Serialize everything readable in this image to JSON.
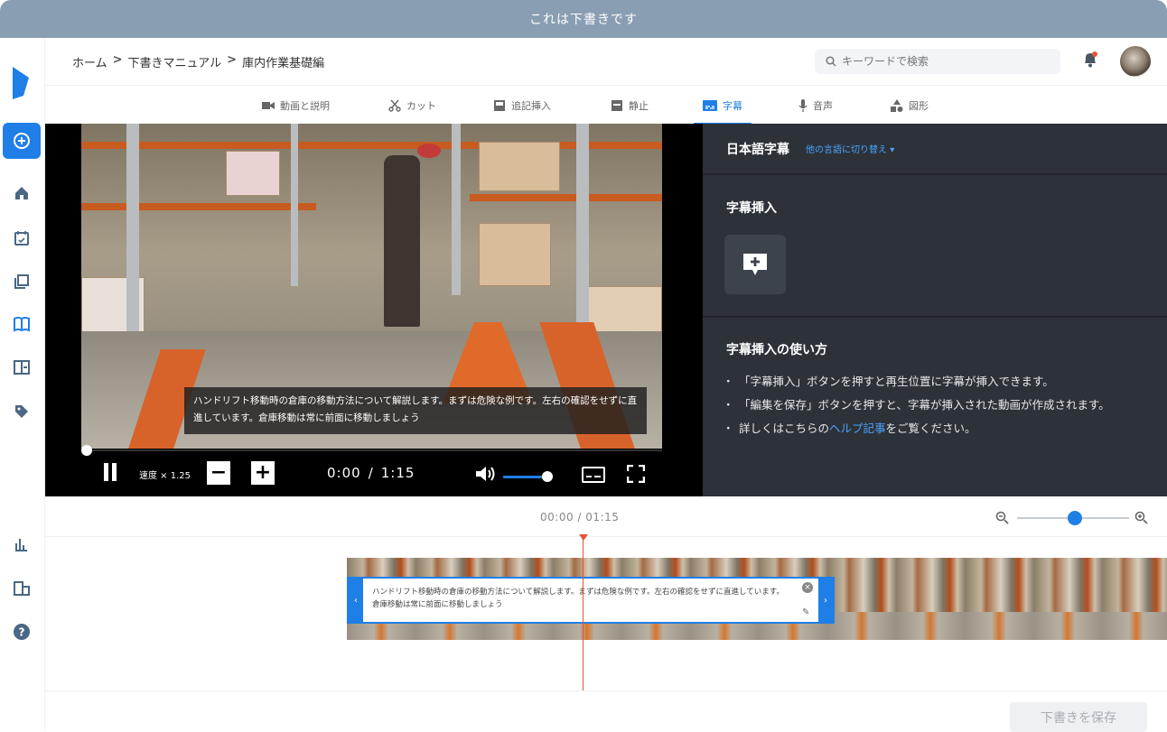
{
  "banner": {
    "text": "これは下書きです"
  },
  "breadcrumb": {
    "items": [
      "ホーム",
      "下書きマニュアル",
      "庫内作業基礎編"
    ],
    "separator": ">"
  },
  "search": {
    "placeholder": "キーワードで検索",
    "icon": "search-icon"
  },
  "sidebar": {
    "items": [
      {
        "icon": "add-circle-icon",
        "active": true
      },
      {
        "icon": "home-icon"
      },
      {
        "icon": "calendar-check-icon"
      },
      {
        "icon": "stacked-pages-icon"
      },
      {
        "icon": "book-icon"
      },
      {
        "icon": "panel-icon"
      },
      {
        "icon": "tag-icon"
      },
      {
        "icon": "bar-chart-icon"
      },
      {
        "icon": "building-icon"
      },
      {
        "icon": "help-icon"
      }
    ]
  },
  "tabs": [
    {
      "label": "動画と説明",
      "icon": "video-camera-icon"
    },
    {
      "label": "カット",
      "icon": "scissors-icon"
    },
    {
      "label": "追記挿入",
      "icon": "insert-icon"
    },
    {
      "label": "静止",
      "icon": "freeze-icon"
    },
    {
      "label": "字幕",
      "icon": "subtitles-icon",
      "active": true
    },
    {
      "label": "音声",
      "icon": "microphone-icon"
    },
    {
      "label": "図形",
      "icon": "shapes-icon"
    }
  ],
  "player": {
    "caption": "ハンドリフト移動時の倉庫の移動方法について解説します。まずは危険な例です。左右の確認をせずに直進しています。倉庫移動は常に前面に移動しましょう",
    "speed_label": "速度 × 1.25",
    "minus": "−",
    "plus": "+",
    "current_time": "0:00",
    "time_separator": "/",
    "duration": "1:15",
    "progress": 0,
    "volume": 0.85
  },
  "panel": {
    "title": "日本語字幕",
    "switch_language": "他の言語に切り替え",
    "insert_label": "字幕挿入",
    "howto_title": "字幕挿入の使い方",
    "howto": {
      "item1": "「字幕挿入」ボタンを押すと再生位置に字幕が挿入できます。",
      "item2": "「編集を保存」ボタンを押すと、字幕が挿入された動画が作成されます。",
      "item3_before": "詳しくはこちらの",
      "item3_link": "ヘルプ記事",
      "item3_after": "をご覧ください。"
    }
  },
  "timeline": {
    "time": "00:00 / 01:15",
    "zoom_level": 0.55,
    "subtitle_clip_text": "ハンドリフト移動時の倉庫の移動方法について解説します。まずは危険な例です。左右の確認をせずに直進しています。倉庫移動は常に前面に移動しましょう"
  },
  "footer": {
    "save_label": "下書きを保存"
  },
  "colors": {
    "accent": "#1f7fe6",
    "banner": "#8a9eb3",
    "panel_bg": "#2d3239",
    "playhead": "#e5533a"
  }
}
